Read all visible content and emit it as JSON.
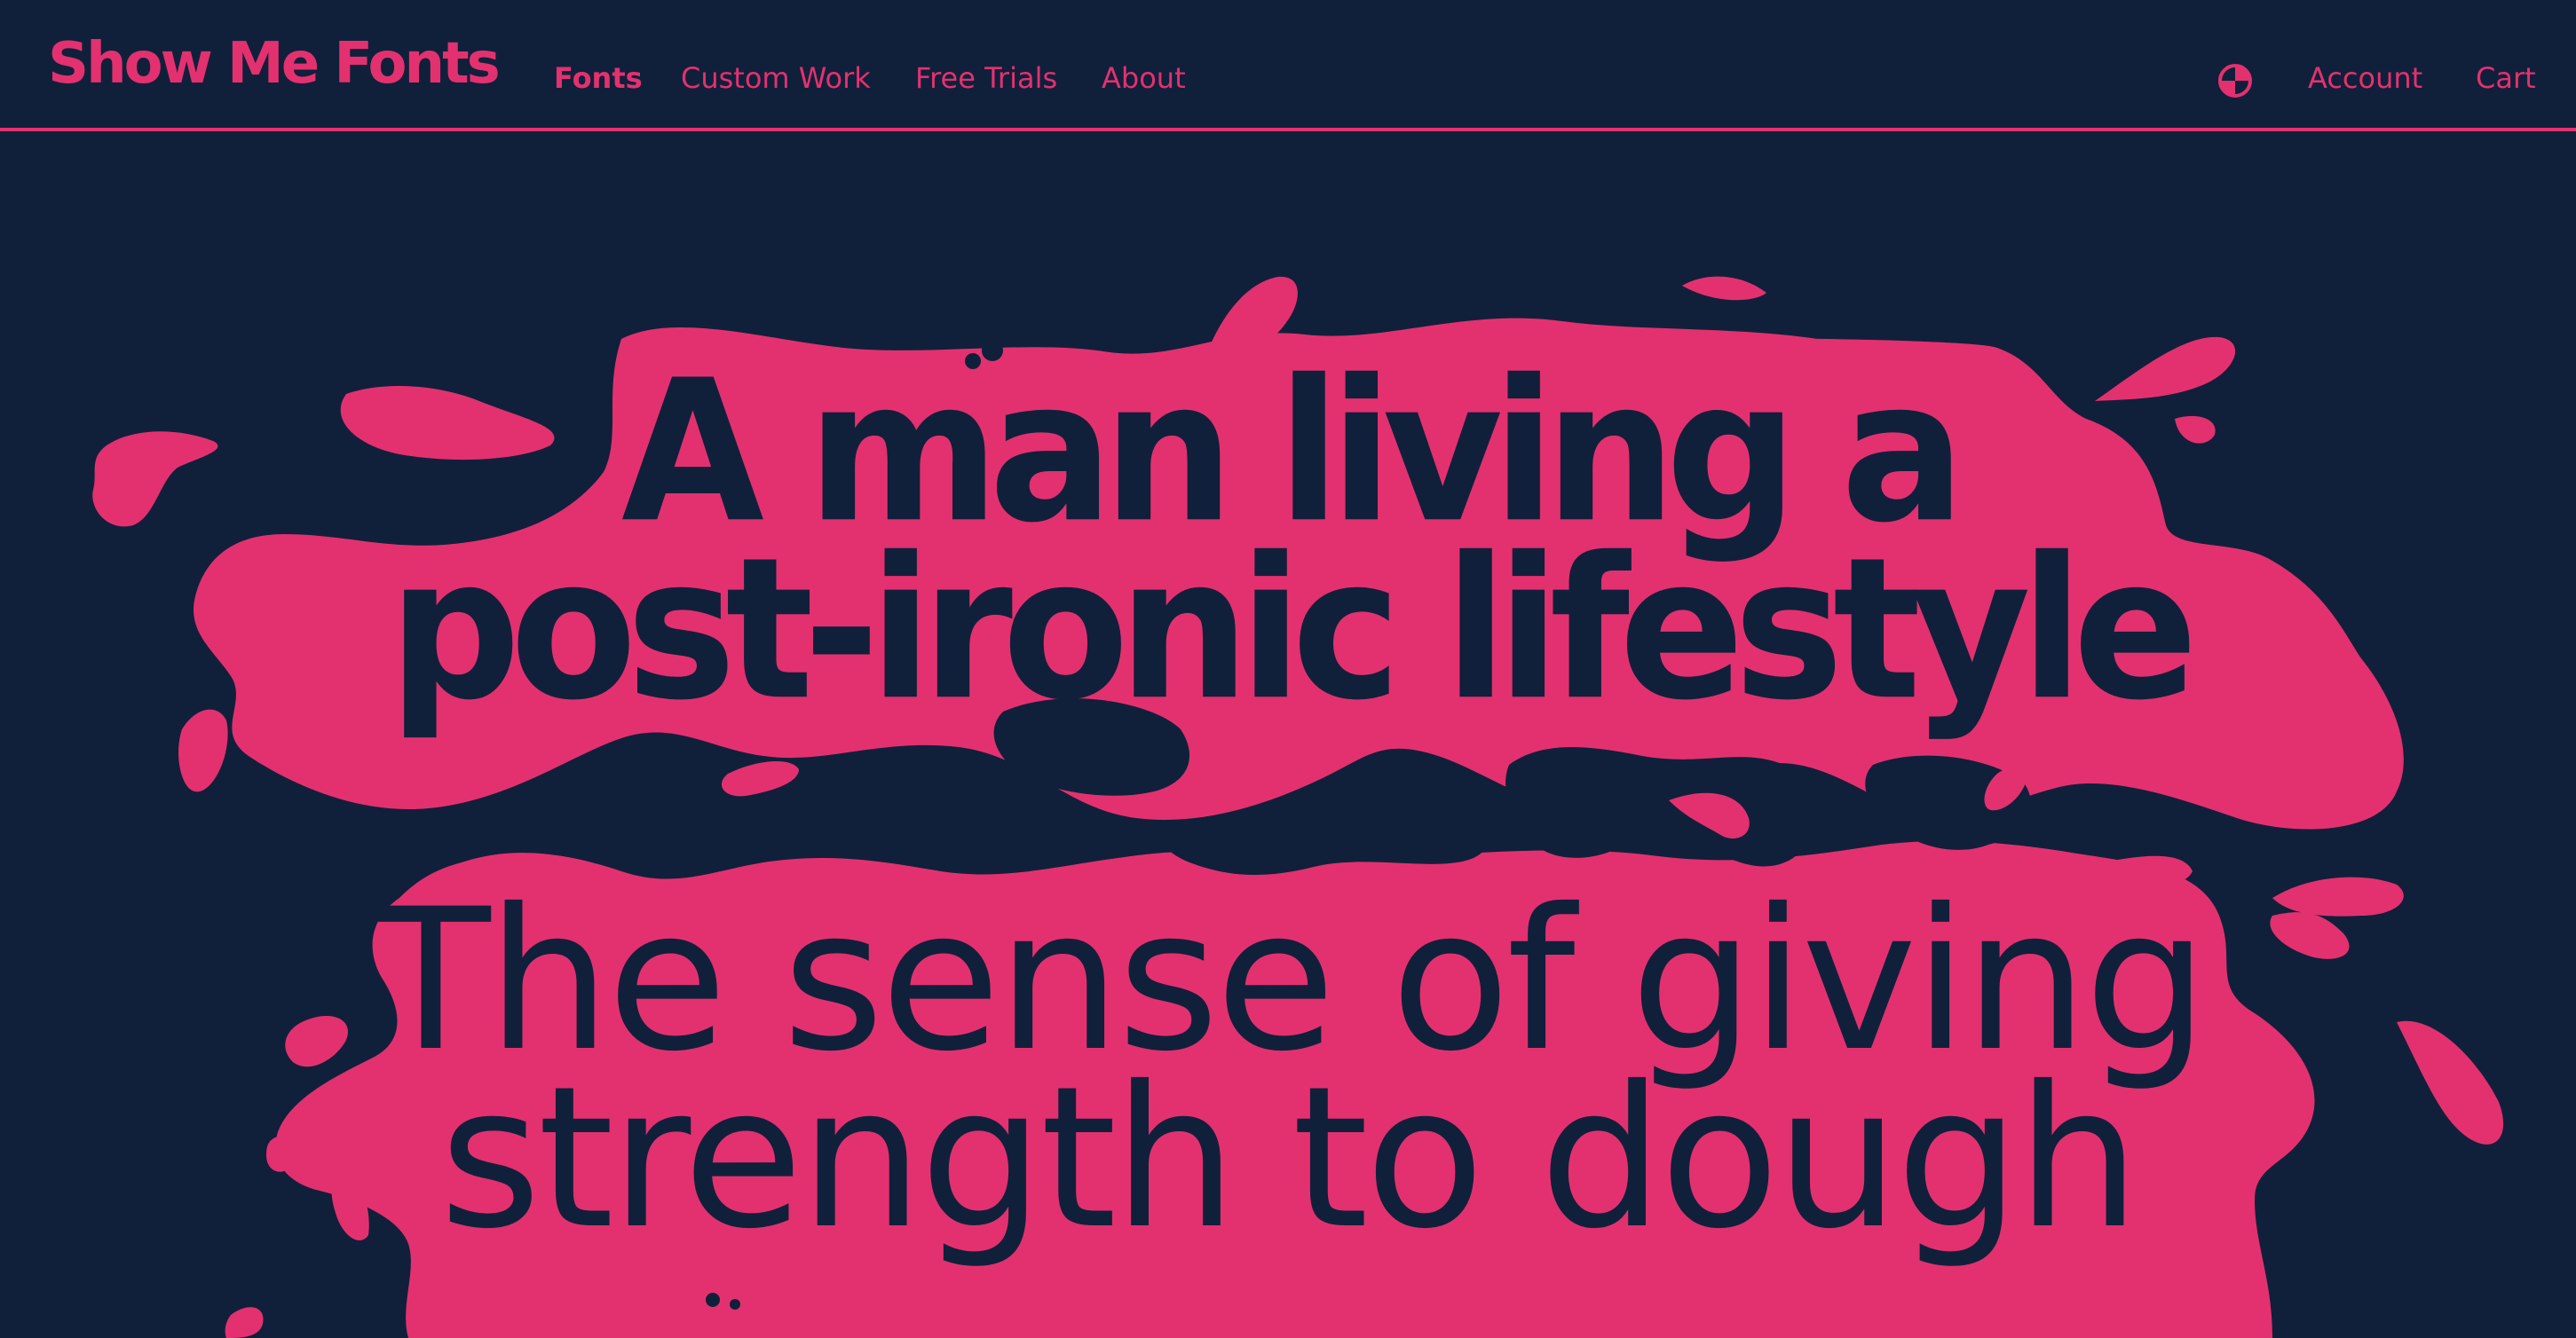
{
  "header": {
    "logo": "Show Me Fonts",
    "nav": [
      "Fonts",
      "Custom Work",
      "Free Trials",
      "About"
    ],
    "globe_icon": "globe-icon",
    "account": "Account",
    "cart": "Cart"
  },
  "hero": {
    "headline_one": [
      "A man living a",
      "post-ironic lifestyle"
    ],
    "headline_two": [
      "The sense of giving",
      "strength to dough"
    ]
  },
  "colors": {
    "background": "#10203a",
    "accent": "#e33170"
  }
}
